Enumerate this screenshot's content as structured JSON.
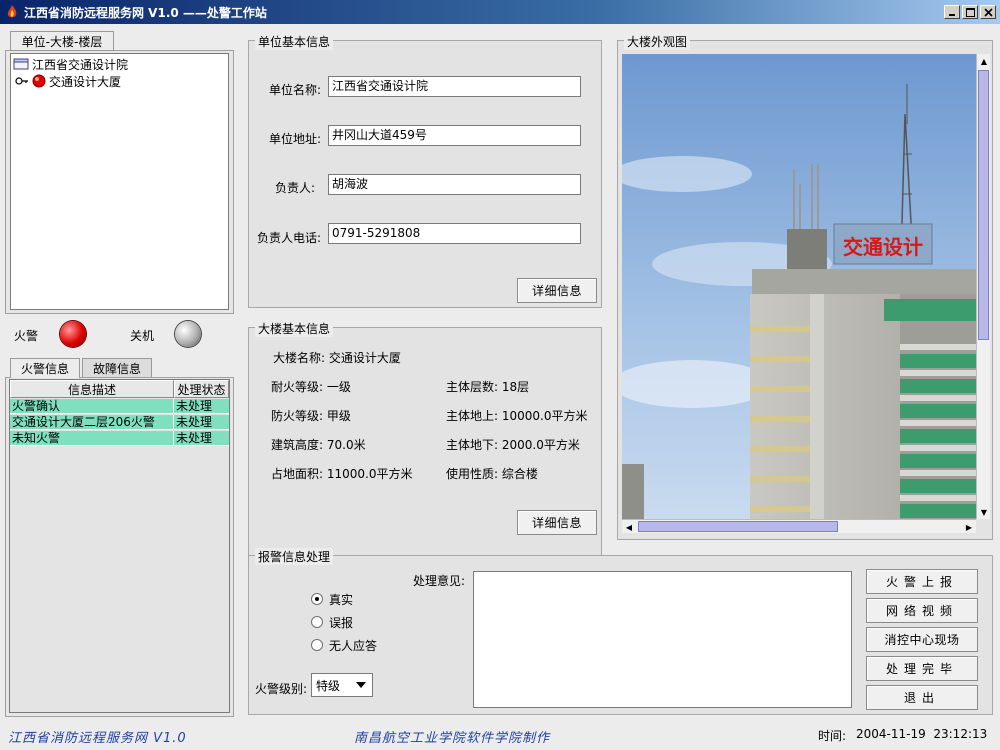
{
  "window": {
    "title": "江西省消防远程服务网 V1.0 ——处警工作站"
  },
  "left": {
    "tree_tab_label": "单位-大楼-楼层",
    "tree": {
      "root": "江西省交通设计院",
      "child": "交通设计大厦"
    },
    "indicators": {
      "fire_label": "火警",
      "off_label": "关机"
    },
    "tabs": [
      {
        "label": "火警信息"
      },
      {
        "label": "故障信息"
      }
    ],
    "table": {
      "columns": [
        "信息描述",
        "处理状态"
      ],
      "rows": [
        {
          "desc": "火警确认",
          "status": "未处理"
        },
        {
          "desc": "交通设计大厦二层206火警",
          "status": "未处理"
        },
        {
          "desc": "未知火警",
          "status": "未处理"
        }
      ]
    }
  },
  "unit": {
    "title": "单位基本信息",
    "name_label": "单位名称:",
    "name_value": "江西省交通设计院",
    "address_label": "单位地址:",
    "address_value": "井冈山大道459号",
    "person_label": "负责人:",
    "person_value": "胡海波",
    "phone_label": "负责人电话:",
    "phone_value": "0791-5291808",
    "detail_button": "详细信息"
  },
  "building": {
    "title": "大楼基本信息",
    "name": "大楼名称: 交通设计大厦",
    "fire_rating": "耐火等级: 一级",
    "floors": "主体层数: 18层",
    "fire_class": "防火等级: 甲级",
    "above_area": "主体地上: 10000.0平方米",
    "height": "建筑高度: 70.0米",
    "below_area": "主体地下: 2000.0平方米",
    "land_area": "占地面积: 11000.0平方米",
    "usage": "使用性质: 综合楼",
    "detail_button": "详细信息"
  },
  "exterior": {
    "title": "大楼外观图",
    "sign_text": "交通设计"
  },
  "alarm": {
    "title": "报警信息处理",
    "opinion_label": "处理意见:",
    "radios": [
      {
        "label": "真实",
        "checked": true
      },
      {
        "label": "误报",
        "checked": false
      },
      {
        "label": "无人应答",
        "checked": false
      }
    ],
    "level_label": "火警级别:",
    "level_value": "特级",
    "buttons": [
      "火警上报",
      "网络视频",
      "消控中心现场",
      "处理完毕",
      "退出"
    ]
  },
  "footer": {
    "left_text": "江西省消防远程服务网 V1.0",
    "center_text": "南昌航空工业学院软件学院制作",
    "time_label": "时间:",
    "time_value": "2004-11-19  23:12:13"
  },
  "colors": {
    "row_highlight": "#7fe0c0",
    "footer_text": "#2040a0"
  }
}
